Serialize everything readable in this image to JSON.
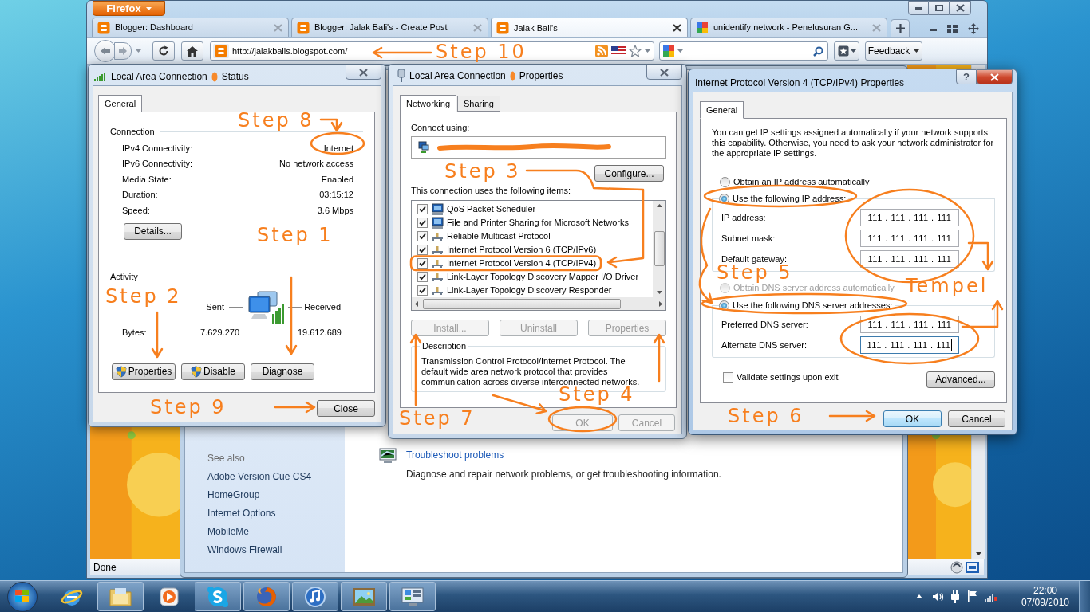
{
  "browser": {
    "menu_button": "Firefox",
    "tabs": [
      {
        "title": "Blogger: Dashboard",
        "kind": "blogger",
        "selected": false
      },
      {
        "title": "Blogger: Jalak Bali's - Create Post",
        "kind": "blogger",
        "selected": false
      },
      {
        "title": "Jalak Bali's",
        "kind": "blogger",
        "selected": true
      },
      {
        "title": "unidentify network - Penelusuran G...",
        "kind": "google",
        "selected": false
      }
    ],
    "url": "http://jalakbalis.blogspot.com/",
    "feedback_button": "Feedback",
    "status": "Done"
  },
  "control_panel": {
    "see_also_heading": "See also",
    "see_also": [
      "Adobe Version Cue CS4",
      "HomeGroup",
      "Internet Options",
      "MobileMe",
      "Windows Firewall"
    ],
    "task_link": "Troubleshoot problems",
    "task_description": "Diagnose and repair network problems, or get troubleshooting information."
  },
  "status_dialog": {
    "title_parts": [
      "Local Area Connection",
      "Status"
    ],
    "tabs": [
      {
        "label": "General",
        "selected": true
      }
    ],
    "connection_heading": "Connection",
    "connection": [
      {
        "label": "IPv4 Connectivity:",
        "value": "Internet"
      },
      {
        "label": "IPv6 Connectivity:",
        "value": "No network access"
      },
      {
        "label": "Media State:",
        "value": "Enabled"
      },
      {
        "label": "Duration:",
        "value": "03:15:12"
      },
      {
        "label": "Speed:",
        "value": "3.6 Mbps"
      }
    ],
    "details_button": "Details...",
    "activity_heading": "Activity",
    "sent_label": "Sent",
    "received_label": "Received",
    "bytes_label": "Bytes:",
    "bytes_sent": "7.629.270",
    "bytes_received": "19.612.689",
    "buttons": [
      {
        "label": "Properties",
        "shield": true
      },
      {
        "label": "Disable",
        "shield": true
      },
      {
        "label": "Diagnose",
        "shield": false
      }
    ],
    "close_button": "Close"
  },
  "properties_dialog": {
    "title_parts": [
      "Local Area Connection",
      "Properties"
    ],
    "tabs": [
      {
        "label": "Networking",
        "selected": true
      },
      {
        "label": "Sharing",
        "selected": false
      }
    ],
    "connect_using_label": "Connect using:",
    "configure_button": "Configure...",
    "items_label": "This connection uses the following items:",
    "items": [
      {
        "label": "QoS Packet Scheduler",
        "kind": "service",
        "checked": true
      },
      {
        "label": "File and Printer Sharing for Microsoft Networks",
        "kind": "service",
        "checked": true
      },
      {
        "label": "Reliable Multicast Protocol",
        "kind": "protocol",
        "checked": true
      },
      {
        "label": "Internet Protocol Version 6 (TCP/IPv6)",
        "kind": "protocol",
        "checked": true
      },
      {
        "label": "Internet Protocol Version 4 (TCP/IPv4)",
        "kind": "protocol",
        "checked": true
      },
      {
        "label": "Link-Layer Topology Discovery Mapper I/O Driver",
        "kind": "protocol",
        "checked": true
      },
      {
        "label": "Link-Layer Topology Discovery Responder",
        "kind": "protocol",
        "checked": true
      }
    ],
    "buttons": [
      {
        "label": "Install...",
        "disabled": true
      },
      {
        "label": "Uninstall",
        "disabled": true
      },
      {
        "label": "Properties",
        "disabled": true
      }
    ],
    "description_heading": "Description",
    "description": "Transmission Control Protocol/Internet Protocol. The default wide area network protocol that provides communication across diverse interconnected networks.",
    "ok_button": {
      "label": "OK",
      "disabled": true
    },
    "cancel_button": {
      "label": "Cancel",
      "disabled": true
    }
  },
  "ipv4_dialog": {
    "title": "Internet Protocol Version 4 (TCP/IPv4) Properties",
    "help_button": "?",
    "tabs": [
      {
        "label": "General",
        "selected": true
      }
    ],
    "intro": "You can get IP settings assigned automatically if your network supports this capability. Otherwise, you need to ask your network administrator for the appropriate IP settings.",
    "ip_options": [
      {
        "label": "Obtain an IP address automatically",
        "selected": false,
        "disabled": false
      },
      {
        "label": "Use the following IP address:",
        "selected": true,
        "disabled": false
      }
    ],
    "ip_fields": [
      {
        "label": "IP address:",
        "value": "111 . 111 . 111 . 111"
      },
      {
        "label": "Subnet mask:",
        "value": "111 . 111 . 111 . 111"
      },
      {
        "label": "Default gateway:",
        "value": "111 . 111 . 111 . 111"
      }
    ],
    "dns_options": [
      {
        "label": "Obtain DNS server address automatically",
        "selected": false,
        "disabled": true
      },
      {
        "label": "Use the following DNS server addresses:",
        "selected": true,
        "disabled": false
      }
    ],
    "dns_fields": [
      {
        "label": "Preferred DNS server:",
        "value": "111 . 111 . 111 . 111",
        "focused": false
      },
      {
        "label": "Alternate DNS server:",
        "value": "111 . 111 . 111 . 111",
        "focused": true
      }
    ],
    "validate": {
      "label": "Validate settings upon exit",
      "checked": false
    },
    "advanced_button": "Advanced...",
    "ok_button": "OK",
    "cancel_button": "Cancel"
  },
  "annotations": [
    {
      "text": "Step 10"
    },
    {
      "text": "Step 8"
    },
    {
      "text": "Step 3"
    },
    {
      "text": "Step 1"
    },
    {
      "text": "Tempel"
    },
    {
      "text": "Step 5"
    },
    {
      "text": "Step 2"
    },
    {
      "text": "Step 4"
    },
    {
      "text": "Step 9"
    },
    {
      "text": "Step 7"
    },
    {
      "text": "Step 6"
    }
  ],
  "taskbar": {
    "items": [
      {
        "kind": "ie",
        "running": false
      },
      {
        "kind": "explorer",
        "running": true
      },
      {
        "kind": "media",
        "running": false
      },
      {
        "kind": "chat",
        "running": true
      },
      {
        "kind": "firefox",
        "running": true
      },
      {
        "kind": "music",
        "running": true
      },
      {
        "kind": "photos",
        "running": true
      },
      {
        "kind": "settings",
        "running": true
      }
    ],
    "time": "22:00",
    "date": "07/09/2010"
  }
}
